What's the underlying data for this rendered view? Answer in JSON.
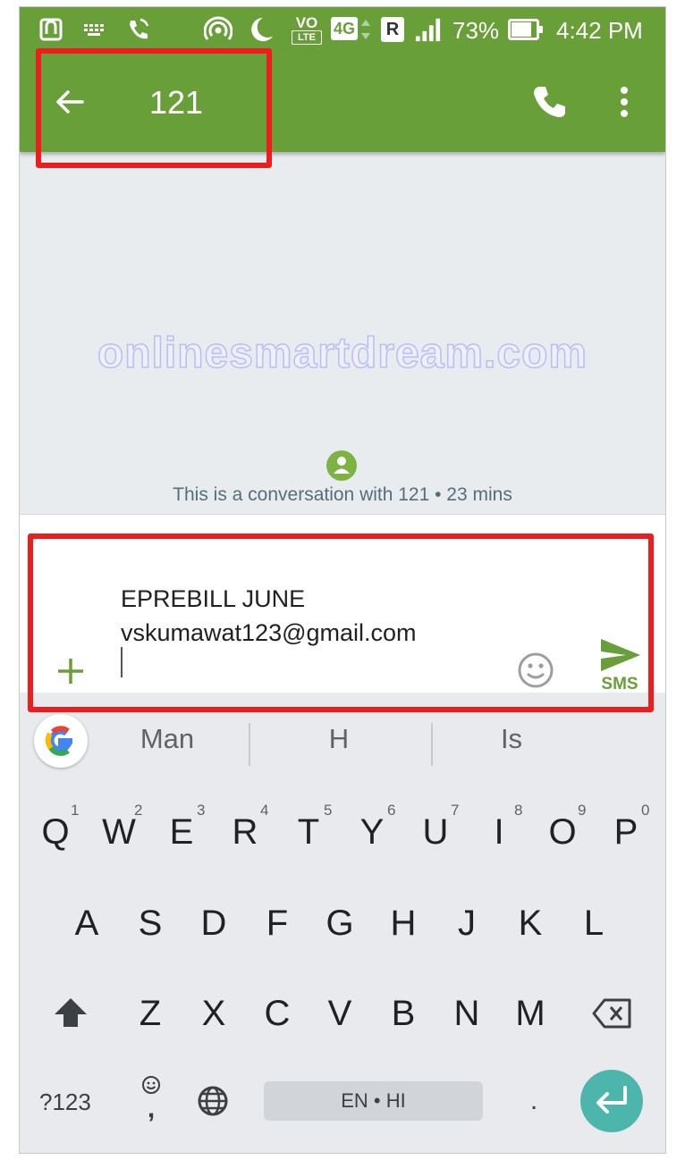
{
  "status_bar": {
    "battery": "73%",
    "time": "4:42 PM",
    "network_type": "4G",
    "roaming": "R",
    "volte_top": "VO",
    "volte_bottom": "LTE"
  },
  "toolbar": {
    "title": "121",
    "back_icon": "arrow-back-icon",
    "call_icon": "phone-icon",
    "menu_icon": "more-vert-icon"
  },
  "watermark": "onlinesmartdream.com",
  "conversation": {
    "info": "This is a conversation with 121 • 23 mins"
  },
  "compose": {
    "line1": "EPREBILL JUNE",
    "line2": "vskumawat123@gmail.com",
    "send_label": "SMS"
  },
  "suggestions": [
    "Man",
    "H",
    "Is"
  ],
  "keyboard": {
    "row1": [
      "Q",
      "W",
      "E",
      "R",
      "T",
      "Y",
      "U",
      "I",
      "O",
      "P"
    ],
    "row1_hints": [
      "1",
      "2",
      "3",
      "4",
      "5",
      "6",
      "7",
      "8",
      "9",
      "0"
    ],
    "row2": [
      "A",
      "S",
      "D",
      "F",
      "G",
      "H",
      "J",
      "K",
      "L"
    ],
    "row3": [
      "Z",
      "X",
      "C",
      "V",
      "B",
      "N",
      "M"
    ],
    "symbols_key": "?123",
    "emoji_comma": ",",
    "space_label": "EN • HI",
    "period": "."
  },
  "colors": {
    "app_bar": "#689f38",
    "accent": "#689f38",
    "highlight": "#ee1c1c",
    "enter": "#4db6ac"
  }
}
